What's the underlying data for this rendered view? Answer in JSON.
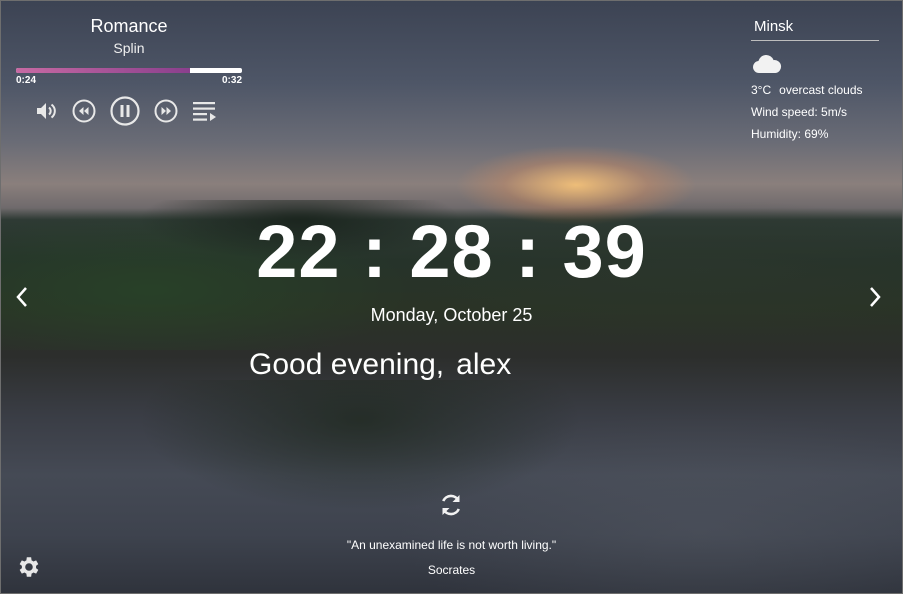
{
  "player": {
    "title": "Romance",
    "artist": "Splin",
    "current_time": "0:24",
    "duration": "0:32",
    "progress": 0.77,
    "accent_color": "#c76aa3",
    "controls": [
      "volume-icon",
      "rewind-icon",
      "pause-icon",
      "fast-forward-icon",
      "playlist-icon"
    ]
  },
  "weather": {
    "city": "Minsk",
    "icon": "cloud-icon",
    "temperature": "3°C",
    "description": "overcast clouds",
    "wind": "Wind speed: 5m/s",
    "humidity": "Humidity: 69%"
  },
  "clock": {
    "hours": "22",
    "minutes": "28",
    "seconds": "39",
    "separator": ":"
  },
  "date": "Monday, October 25",
  "greeting": {
    "text": "Good evening,",
    "name": "alex"
  },
  "quote": {
    "text": "\"An unexamined life is not worth living.\"",
    "author": "Socrates"
  },
  "icons": {
    "prev": "chevron-left-icon",
    "next": "chevron-right-icon",
    "refresh": "refresh-icon",
    "settings": "gear-icon"
  }
}
